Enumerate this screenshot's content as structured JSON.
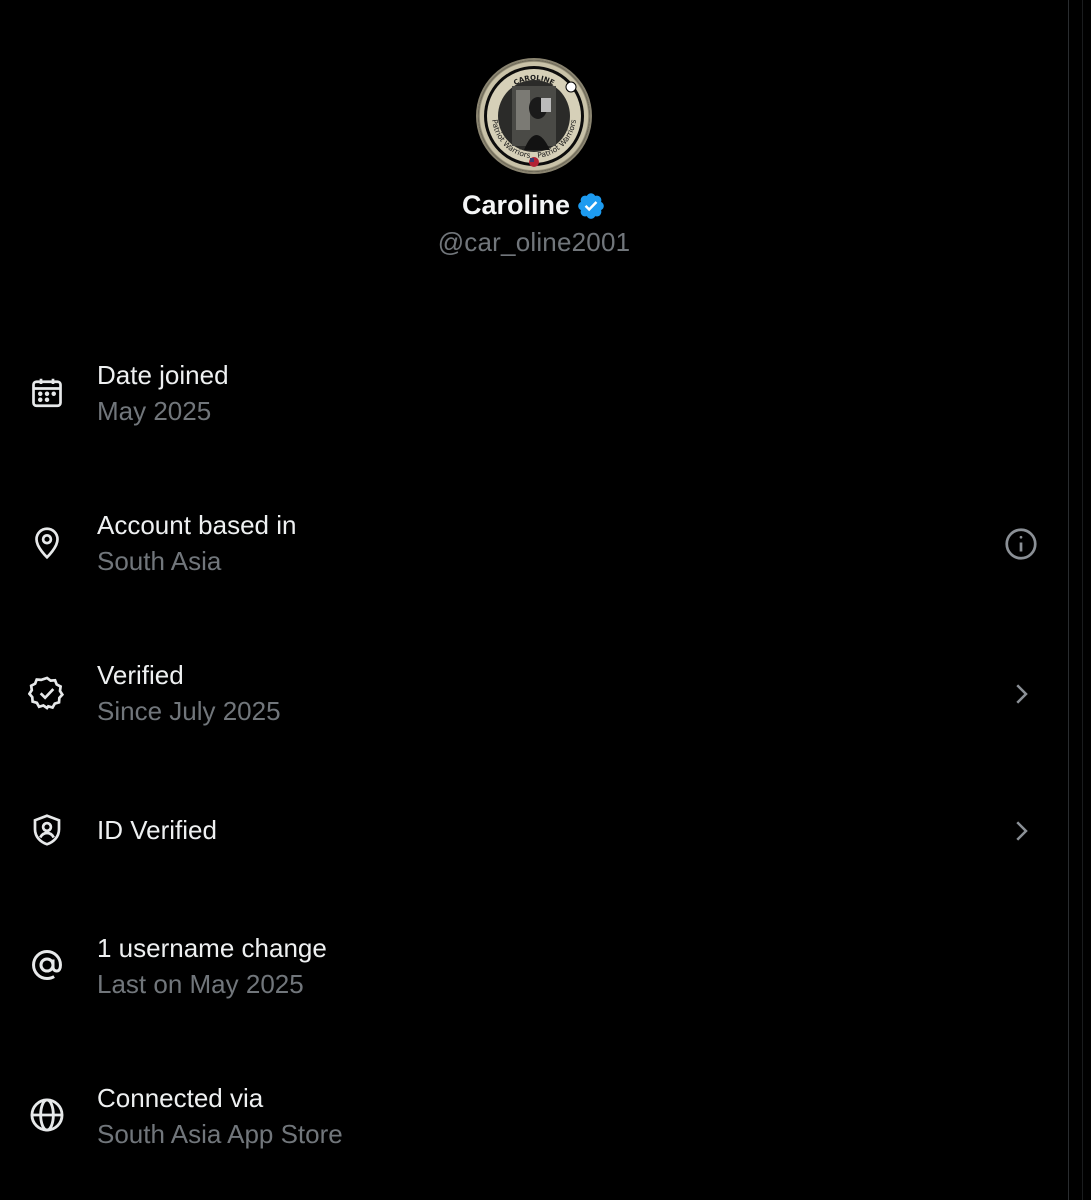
{
  "profile": {
    "display_name": "Caroline",
    "handle": "@car_oline2001",
    "verified_badge_color": "#1d9bf0",
    "avatar_ring_text": [
      "CAROLINE",
      "Patriot Warriors",
      "Patriot Warriors"
    ]
  },
  "rows": [
    {
      "icon": "calendar-icon",
      "title": "Date joined",
      "sub": "May 2025",
      "trail": ""
    },
    {
      "icon": "location-pin-icon",
      "title": "Account based in",
      "sub": "South Asia",
      "trail": "info-icon"
    },
    {
      "icon": "verified-check-icon",
      "title": "Verified",
      "sub": "Since July 2025",
      "trail": "chevron-right-icon"
    },
    {
      "icon": "id-shield-icon",
      "title": "ID Verified",
      "sub": "",
      "trail": "chevron-right-icon"
    },
    {
      "icon": "at-sign-icon",
      "title": "1 username change",
      "sub": "Last on May 2025",
      "trail": ""
    },
    {
      "icon": "globe-icon",
      "title": "Connected via",
      "sub": "South Asia App Store",
      "trail": ""
    }
  ],
  "colors": {
    "background": "#000000",
    "primary_text": "#e7e9ea",
    "secondary_text": "#71767b",
    "accent": "#1d9bf0"
  }
}
